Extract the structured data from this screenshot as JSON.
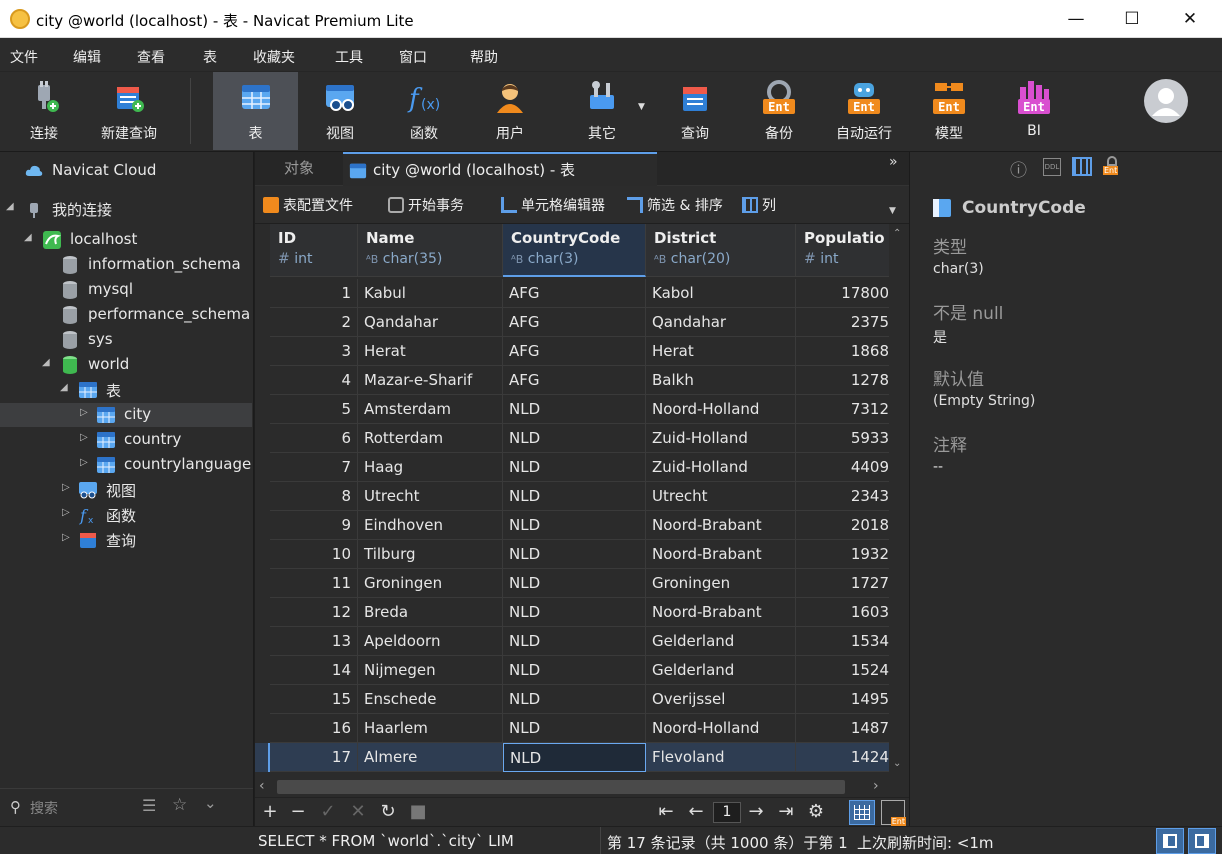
{
  "window": {
    "title": "city @world (localhost) - 表 - Navicat Premium Lite",
    "min": "—",
    "max": "☐",
    "close": "✕"
  },
  "menu": [
    "文件",
    "编辑",
    "查看",
    "表",
    "收藏夹",
    "工具",
    "窗口",
    "帮助"
  ],
  "toolbar": {
    "connect": "连接",
    "new_query": "新建查询",
    "table": "表",
    "view": "视图",
    "function": "函数",
    "user": "用户",
    "other": "其它",
    "query": "查询",
    "backup": "备份",
    "auto_run": "自动运行",
    "model": "模型",
    "bi": "BI",
    "ent_badge": "Ent"
  },
  "sidebar": {
    "cloud": "Navicat Cloud",
    "my_connections": "我的连接",
    "connection": "localhost",
    "schemas": [
      "information_schema",
      "mysql",
      "performance_schema",
      "sys",
      "world"
    ],
    "tables_group": "表",
    "tables": [
      "city",
      "country",
      "countrylanguage"
    ],
    "views": "视图",
    "functions": "函数",
    "queries": "查询",
    "search_placeholder": "搜索"
  },
  "tabs": {
    "objects": "对象",
    "active": "city @world (localhost) - 表"
  },
  "subtoolbar": {
    "profile": "表配置文件",
    "begin_tx": "开始事务",
    "cell_editor": "单元格编辑器",
    "filter_sort": "筛选 & 排序",
    "columns": "列"
  },
  "grid": {
    "columns": [
      {
        "name": "ID",
        "type": "int"
      },
      {
        "name": "Name",
        "type": "char(35)"
      },
      {
        "name": "CountryCode",
        "type": "char(3)"
      },
      {
        "name": "District",
        "type": "char(20)"
      },
      {
        "name": "Populatio",
        "type": "int"
      }
    ],
    "rows": [
      [
        "1",
        "Kabul",
        "AFG",
        "Kabol",
        "17800"
      ],
      [
        "2",
        "Qandahar",
        "AFG",
        "Qandahar",
        "2375"
      ],
      [
        "3",
        "Herat",
        "AFG",
        "Herat",
        "1868"
      ],
      [
        "4",
        "Mazar-e-Sharif",
        "AFG",
        "Balkh",
        "1278"
      ],
      [
        "5",
        "Amsterdam",
        "NLD",
        "Noord-Holland",
        "7312"
      ],
      [
        "6",
        "Rotterdam",
        "NLD",
        "Zuid-Holland",
        "5933"
      ],
      [
        "7",
        "Haag",
        "NLD",
        "Zuid-Holland",
        "4409"
      ],
      [
        "8",
        "Utrecht",
        "NLD",
        "Utrecht",
        "2343"
      ],
      [
        "9",
        "Eindhoven",
        "NLD",
        "Noord-Brabant",
        "2018"
      ],
      [
        "10",
        "Tilburg",
        "NLD",
        "Noord-Brabant",
        "1932"
      ],
      [
        "11",
        "Groningen",
        "NLD",
        "Groningen",
        "1727"
      ],
      [
        "12",
        "Breda",
        "NLD",
        "Noord-Brabant",
        "1603"
      ],
      [
        "13",
        "Apeldoorn",
        "NLD",
        "Gelderland",
        "1534"
      ],
      [
        "14",
        "Nijmegen",
        "NLD",
        "Gelderland",
        "1524"
      ],
      [
        "15",
        "Enschede",
        "NLD",
        "Overijssel",
        "1495"
      ],
      [
        "16",
        "Haarlem",
        "NLD",
        "Noord-Holland",
        "1487"
      ],
      [
        "17",
        "Almere",
        "NLD",
        "Flevoland",
        "1424"
      ]
    ],
    "selected_row": 17,
    "page": "1"
  },
  "field_info": {
    "field": "CountryCode",
    "type_label": "类型",
    "type_value": "char(3)",
    "notnull_label": "不是 null",
    "notnull_value": "是",
    "default_label": "默认值",
    "default_value": "(Empty String)",
    "comment_label": "注释",
    "comment_value": "--"
  },
  "status": {
    "sql": "SELECT * FROM `world`.`city` LIM",
    "record": "第 17 条记录（共 1000 条）于第 1 页",
    "refresh": "上次刷新时间: <1m"
  },
  "colors": {
    "accent": "#5e9ee8",
    "ent": "#f08a1d",
    "bg": "#2b2b2b"
  }
}
